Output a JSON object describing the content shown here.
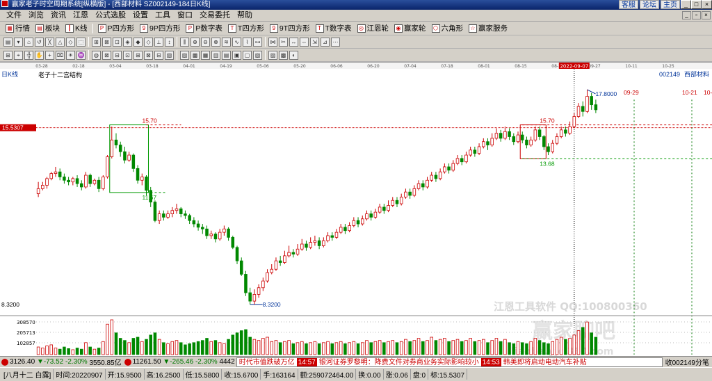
{
  "window": {
    "title": "赢家老子时空周期系统[纵横版] - [西部材料 SZ002149-184日K线]",
    "links": [
      "客服",
      "论坛",
      "主页"
    ]
  },
  "menu": [
    "文件",
    "浏览",
    "资讯",
    "江恩",
    "公式选股",
    "设置",
    "工具",
    "窗口",
    "交易委托",
    "帮助"
  ],
  "toolbar1": [
    {
      "icon": "grid-icon",
      "label": "行情"
    },
    {
      "icon": "blocks-icon",
      "label": "板块"
    },
    {
      "icon": "kline-icon",
      "label": "K线"
    },
    {
      "icon": "square-icon",
      "label": "P四方形"
    },
    {
      "icon": "square-icon",
      "label": "9P四方形"
    },
    {
      "icon": "square-icon",
      "label": "P数字表"
    },
    {
      "icon": "square-icon",
      "label": "T四方形"
    },
    {
      "icon": "square-icon",
      "label": "9T四方形"
    },
    {
      "icon": "square-icon",
      "label": "T数字表"
    },
    {
      "icon": "wheel-icon",
      "label": "江恩轮"
    },
    {
      "icon": "wheel-icon",
      "label": "赢家轮"
    },
    {
      "icon": "hexagon-icon",
      "label": "六角形"
    },
    {
      "icon": "service-icon",
      "label": "赢家服务"
    }
  ],
  "chart": {
    "period_label": "日K线",
    "structure_label": "老子十二宫结构",
    "stock_code": "002149",
    "stock_name": "西部材料",
    "cursor_price": "15.5307",
    "cursor_date": "2022-09-07",
    "axis_price_label": "8.3200",
    "date_ticks": [
      "03-28",
      "02-18",
      "03-04",
      "03-18",
      "04-01",
      "04-19",
      "05-06",
      "05-20",
      "06-06",
      "06-20",
      "07-04",
      "07-18",
      "08-01",
      "08-15",
      "08-29",
      "09-27",
      "10-11",
      "10-25"
    ],
    "future_dates": [
      "09-29",
      "10-21",
      "10-"
    ],
    "markers": {
      "high_left": "15.70",
      "low_left": "11.67",
      "high_right": "15.70",
      "low_right": "13.68",
      "bottom": "8.3200",
      "top": "17.8000"
    },
    "volume_axis": [
      "308570",
      "205713",
      "102857"
    ],
    "watermark_line1": "江恩工具软件 QQ:100800360",
    "watermark_line2": "赢家聊吧",
    "watermark_line3": "liaoba.yjcl360.com",
    "colors": {
      "up": "#cc0000",
      "down": "#008800",
      "cursor": "#cc0000",
      "box_green": "#009900",
      "box_red": "#cc0000"
    }
  },
  "chart_data": {
    "type": "candlestick",
    "title": "",
    "series": [
      {
        "name": "西部材料",
        "ohlc": [
          [
            11.6,
            11.9,
            12.3,
            11.4
          ],
          [
            11.9,
            12.1,
            12.3,
            11.8
          ],
          [
            12.1,
            12.5,
            12.6,
            11.9
          ],
          [
            12.5,
            12.8,
            12.9,
            12.4
          ],
          [
            12.8,
            12.9,
            13.2,
            12.6
          ],
          [
            12.9,
            12.6,
            13.1,
            12.4
          ],
          [
            12.6,
            12.4,
            12.8,
            12.2
          ],
          [
            12.4,
            12.3,
            12.6,
            12.1
          ],
          [
            12.3,
            12.5,
            12.6,
            12.1
          ],
          [
            12.5,
            12.2,
            12.7,
            12.0
          ],
          [
            12.2,
            12.0,
            12.4,
            11.8
          ],
          [
            12.0,
            12.7,
            12.9,
            11.9
          ],
          [
            12.7,
            12.2,
            12.8,
            12.0
          ],
          [
            12.2,
            12.4,
            12.5,
            12.1
          ],
          [
            12.4,
            11.9,
            12.6,
            11.7
          ],
          [
            11.9,
            12.6,
            12.7,
            11.8
          ],
          [
            12.6,
            13.8,
            13.9,
            12.5
          ],
          [
            13.8,
            14.8,
            15.6,
            13.7
          ],
          [
            14.8,
            14.5,
            15.2,
            14.3
          ],
          [
            14.5,
            14.1,
            14.7,
            13.8
          ],
          [
            14.1,
            13.6,
            14.4,
            13.4
          ],
          [
            13.6,
            13.9,
            14.1,
            13.5
          ],
          [
            13.9,
            13.1,
            14.0,
            12.9
          ],
          [
            13.1,
            12.4,
            13.3,
            12.2
          ],
          [
            12.4,
            12.6,
            12.8,
            12.1
          ],
          [
            12.6,
            11.8,
            12.7,
            11.5
          ],
          [
            11.8,
            11.1,
            12.0,
            10.8
          ],
          [
            11.1,
            10.0,
            11.2,
            9.9
          ],
          [
            10.0,
            10.4,
            10.6,
            9.8
          ],
          [
            10.4,
            10.2,
            10.6,
            10.0
          ],
          [
            10.2,
            10.4,
            10.6,
            10.1
          ],
          [
            10.4,
            10.6,
            10.8,
            10.2
          ],
          [
            10.6,
            10.7,
            11.0,
            10.4
          ],
          [
            10.7,
            10.4,
            10.8,
            10.2
          ],
          [
            10.4,
            10.3,
            10.6,
            10.1
          ],
          [
            10.3,
            10.0,
            10.4,
            9.8
          ],
          [
            10.0,
            9.8,
            10.2,
            9.6
          ],
          [
            9.8,
            9.6,
            10.0,
            9.4
          ],
          [
            9.6,
            9.5,
            9.8,
            9.2
          ],
          [
            9.5,
            9.1,
            9.7,
            8.9
          ],
          [
            9.1,
            9.2,
            9.4,
            8.9
          ],
          [
            9.2,
            8.9,
            9.3,
            8.7
          ],
          [
            8.9,
            9.3,
            9.5,
            8.8
          ],
          [
            9.3,
            9.5,
            9.7,
            9.1
          ],
          [
            9.5,
            9.0,
            9.6,
            8.8
          ],
          [
            9.0,
            8.4,
            9.1,
            8.3
          ],
          [
            8.4,
            7.6,
            8.5,
            7.4
          ],
          [
            7.6,
            6.8,
            7.8,
            6.7
          ],
          [
            6.8,
            5.7,
            7.0,
            5.5
          ],
          [
            5.7,
            5.2,
            6.0,
            5.0
          ],
          [
            5.2,
            5.6,
            5.9,
            5.0
          ],
          [
            5.6,
            6.0,
            6.2,
            5.4
          ],
          [
            6.0,
            6.4,
            6.6,
            5.8
          ],
          [
            6.4,
            6.9,
            7.1,
            6.3
          ],
          [
            6.9,
            7.1,
            7.4,
            6.8
          ],
          [
            7.1,
            7.6,
            7.8,
            7.0
          ],
          [
            7.6,
            7.5,
            7.9,
            7.3
          ],
          [
            7.5,
            7.9,
            8.2,
            7.4
          ],
          [
            7.9,
            8.1,
            8.5,
            7.8
          ],
          [
            8.1,
            8.0,
            8.3,
            7.8
          ],
          [
            8.0,
            8.3,
            8.6,
            7.9
          ],
          [
            8.3,
            8.6,
            8.9,
            8.2
          ],
          [
            8.6,
            8.4,
            8.8,
            8.2
          ],
          [
            8.4,
            8.7,
            9.0,
            8.3
          ],
          [
            8.7,
            8.8,
            9.1,
            8.5
          ],
          [
            8.8,
            8.5,
            9.0,
            8.3
          ],
          [
            8.5,
            8.8,
            9.0,
            8.4
          ],
          [
            8.8,
            9.1,
            9.3,
            8.7
          ],
          [
            9.1,
            9.0,
            9.3,
            8.8
          ],
          [
            9.0,
            9.3,
            9.5,
            8.9
          ],
          [
            9.3,
            9.6,
            9.8,
            9.2
          ],
          [
            9.6,
            9.4,
            9.8,
            9.2
          ],
          [
            9.4,
            9.7,
            9.9,
            9.3
          ],
          [
            9.7,
            10.0,
            10.2,
            9.6
          ],
          [
            10.0,
            9.8,
            10.2,
            9.6
          ],
          [
            9.8,
            10.1,
            10.3,
            9.7
          ],
          [
            10.1,
            10.4,
            10.6,
            10.0
          ],
          [
            10.4,
            10.2,
            10.6,
            10.0
          ],
          [
            10.2,
            10.5,
            10.7,
            10.1
          ],
          [
            10.5,
            10.8,
            11.0,
            10.4
          ],
          [
            10.8,
            10.6,
            11.0,
            10.4
          ],
          [
            10.6,
            10.9,
            11.2,
            10.5
          ],
          [
            10.9,
            11.2,
            11.4,
            10.8
          ],
          [
            11.2,
            11.0,
            11.4,
            10.8
          ],
          [
            11.0,
            11.4,
            11.6,
            10.9
          ],
          [
            11.4,
            11.7,
            11.9,
            11.3
          ],
          [
            11.7,
            11.5,
            11.9,
            11.3
          ],
          [
            11.5,
            11.9,
            12.1,
            11.4
          ],
          [
            11.9,
            12.2,
            12.4,
            11.8
          ],
          [
            12.2,
            12.0,
            12.4,
            11.8
          ],
          [
            12.0,
            12.4,
            12.6,
            11.9
          ],
          [
            12.4,
            12.7,
            12.9,
            12.3
          ],
          [
            12.7,
            12.5,
            12.9,
            12.3
          ],
          [
            12.5,
            12.9,
            13.1,
            12.4
          ],
          [
            12.9,
            13.2,
            13.4,
            12.8
          ],
          [
            13.2,
            13.0,
            13.4,
            12.8
          ],
          [
            13.0,
            13.4,
            13.6,
            12.9
          ],
          [
            13.4,
            13.7,
            13.9,
            13.3
          ],
          [
            13.7,
            13.5,
            13.9,
            13.3
          ],
          [
            13.5,
            13.9,
            14.1,
            13.4
          ],
          [
            13.9,
            14.2,
            14.4,
            13.8
          ],
          [
            14.2,
            14.0,
            14.4,
            13.8
          ],
          [
            14.0,
            14.4,
            14.6,
            13.9
          ],
          [
            14.4,
            14.7,
            14.9,
            14.3
          ],
          [
            14.7,
            14.5,
            14.9,
            14.2
          ],
          [
            14.5,
            14.9,
            15.2,
            14.4
          ],
          [
            14.9,
            15.2,
            15.5,
            14.8
          ],
          [
            15.2,
            14.9,
            15.4,
            14.7
          ],
          [
            14.9,
            15.3,
            15.6,
            14.8
          ],
          [
            15.3,
            15.0,
            15.5,
            14.8
          ],
          [
            15.0,
            14.7,
            15.2,
            14.5
          ],
          [
            14.7,
            15.1,
            15.3,
            14.6
          ],
          [
            15.1,
            14.8,
            15.3,
            14.6
          ],
          [
            14.8,
            14.5,
            15.0,
            14.3
          ],
          [
            14.5,
            14.8,
            15.0,
            14.4
          ],
          [
            14.8,
            15.4,
            15.6,
            14.7
          ],
          [
            15.4,
            15.0,
            15.6,
            14.8
          ],
          [
            15.0,
            14.4,
            15.1,
            14.2
          ],
          [
            14.4,
            14.1,
            14.6,
            13.9
          ],
          [
            14.1,
            14.6,
            14.8,
            14.0
          ],
          [
            14.6,
            15.0,
            15.2,
            14.5
          ],
          [
            15.0,
            15.4,
            15.6,
            14.9
          ],
          [
            15.4,
            15.2,
            15.6,
            15.0
          ],
          [
            15.2,
            15.6,
            15.9,
            15.1
          ],
          [
            15.6,
            16.2,
            16.4,
            15.5
          ],
          [
            16.2,
            16.8,
            17.0,
            16.1
          ],
          [
            16.8,
            16.5,
            17.1,
            16.2
          ],
          [
            16.5,
            17.4,
            17.8,
            16.4
          ],
          [
            17.4,
            16.9,
            17.6,
            16.6
          ],
          [
            16.9,
            16.6,
            17.2,
            16.4
          ]
        ],
        "volume": [
          70,
          60,
          80,
          90,
          60,
          50,
          70,
          55,
          45,
          60,
          50,
          110,
          70,
          50,
          60,
          120,
          280,
          320,
          200,
          150,
          130,
          110,
          150,
          160,
          120,
          140,
          180,
          200,
          140,
          110,
          100,
          120,
          130,
          110,
          90,
          100,
          110,
          120,
          130,
          150,
          120,
          130,
          110,
          100,
          140,
          180,
          200,
          220,
          230,
          160,
          140,
          130,
          150,
          160,
          120,
          130,
          110,
          120,
          130,
          100,
          110,
          120,
          100,
          110,
          120,
          100,
          110,
          120,
          100,
          110,
          120,
          100,
          110,
          120,
          100,
          110,
          130,
          110,
          120,
          130,
          110,
          120,
          130,
          110,
          120,
          140,
          120,
          130,
          150,
          120,
          130,
          160,
          130,
          140,
          150,
          120,
          130,
          140,
          120,
          130,
          150,
          120,
          130,
          140,
          110,
          130,
          150,
          120,
          140,
          110,
          100,
          120,
          110,
          100,
          120,
          150,
          130,
          110,
          100,
          120,
          140,
          160,
          140,
          150,
          180,
          220,
          250,
          300,
          200,
          160
        ]
      }
    ],
    "xlabel": "",
    "ylabel": "",
    "ylim": [
      4.5,
      18.5
    ],
    "volume_max": 308570
  },
  "ticker": {
    "sh_value": "3126.40",
    "sh_change": "▼-73.52",
    "sh_pct": "-2.30%",
    "sh_amount": "3550.85亿",
    "sz_value": "11261.50",
    "sz_change": "▼-265.46",
    "sz_pct": "-2.30%",
    "sz_amount": "4442",
    "news": [
      {
        "time": "",
        "text": "时代市值跌破万亿"
      },
      {
        "time": "14:57",
        "text": "银河证券罗黎明：降费文件对券商业务实际影响较小"
      },
      {
        "time": "14:53",
        "text": "韩美即将启动电动汽车补贴"
      }
    ],
    "tail": "收002149分笔"
  },
  "status": {
    "weekday": "[八月十二 白露]",
    "time": "时间:20220907",
    "open": "开:15.9500",
    "high": "高:16.2500",
    "low": "低:15.5800",
    "close": "收:15.6700",
    "hand": "手:163164",
    "amount": "额:259072464.00",
    "turnover": "换:0.00",
    "gain": "涨:0.06",
    "pan": "盘:0",
    "mark": "标:15.5307"
  }
}
